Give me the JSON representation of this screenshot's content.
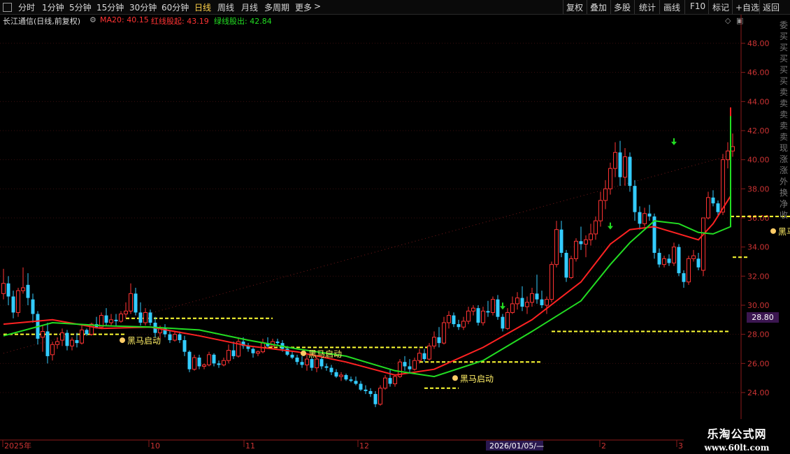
{
  "toolbar": {
    "items": [
      "分时",
      "1分钟",
      "5分钟",
      "15分钟",
      "30分钟",
      "60分钟",
      "日线",
      "周线",
      "月线",
      "多周期",
      "更多"
    ],
    "more_arrow": ">",
    "active": "日线",
    "right_items": [
      "复权",
      "叠加",
      "多股",
      "统计",
      "画线",
      "F10",
      "标记",
      "+自选",
      "返回"
    ]
  },
  "info": {
    "title": "长江通信(日线,前复权)",
    "ma20": "MA20: 40.15",
    "red_line": "红线股起: 43.19",
    "green_line": "绿线股出: 42.84"
  },
  "price_marker": "28.80",
  "right_strip": [
    "委",
    "买",
    "买",
    "买",
    "买",
    "买",
    "卖",
    "卖",
    "卖",
    "卖",
    "卖",
    "现",
    "涨",
    "涨",
    "外",
    "换",
    "净",
    "收"
  ],
  "watermark": {
    "line1": "乐淘公式网",
    "line2": "www.60lt.com"
  },
  "colors": {
    "up": "#ff3333",
    "down": "#33ccff",
    "signal": "#ff33cc",
    "green_bar": "#00dd00",
    "ma_red": "#ff2222",
    "ma_green": "#22dd22",
    "level": "#ffff33",
    "label": "#ffee66"
  },
  "chart_data": {
    "type": "candlestick",
    "y_range": [
      22.8,
      49.2
    ],
    "y_ticks": [
      "24.00",
      "26.00",
      "28.00",
      "30.00",
      "32.00",
      "34.00",
      "36.00",
      "38.00",
      "40.00",
      "42.00",
      "44.00",
      "46.00",
      "48.00"
    ],
    "x_labels": [
      "2025年",
      "10",
      "11",
      "12",
      "2026/01/05/—",
      "2",
      "2",
      "3"
    ],
    "n_bars": 150,
    "candles": [
      {
        "o": 30.8,
        "h": 32.5,
        "l": 30.4,
        "c": 31.5
      },
      {
        "o": 31.5,
        "h": 32.0,
        "l": 30.0,
        "c": 30.6
      },
      {
        "o": 30.6,
        "h": 31.0,
        "l": 29.1,
        "c": 29.5
      },
      {
        "o": 29.5,
        "h": 31.2,
        "l": 29.2,
        "c": 31.0
      },
      {
        "o": 31.0,
        "h": 32.6,
        "l": 30.8,
        "c": 31.2
      },
      {
        "o": 31.4,
        "h": 32.2,
        "l": 30.0,
        "c": 30.5
      },
      {
        "o": 30.4,
        "h": 30.8,
        "l": 28.8,
        "c": 29.4
      },
      {
        "o": 29.4,
        "h": 29.6,
        "l": 27.3,
        "c": 27.7
      },
      {
        "o": 27.8,
        "h": 28.6,
        "l": 26.8,
        "c": 28.2
      },
      {
        "o": 28.2,
        "h": 28.8,
        "l": 26.0,
        "c": 26.5
      },
      {
        "o": 26.6,
        "h": 27.5,
        "l": 26.2,
        "c": 27.3
      },
      {
        "o": 27.3,
        "h": 27.8,
        "l": 27.0,
        "c": 27.5
      },
      {
        "o": 27.6,
        "h": 28.4,
        "l": 27.2,
        "c": 28.1
      },
      {
        "o": 28.1,
        "h": 28.3,
        "l": 26.9,
        "c": 27.2
      },
      {
        "o": 27.2,
        "h": 27.8,
        "l": 26.9,
        "c": 27.6
      },
      {
        "o": 27.6,
        "h": 28.1,
        "l": 27.1,
        "c": 27.4
      },
      {
        "o": 27.4,
        "h": 28.6,
        "l": 27.3,
        "c": 28.3
      },
      {
        "o": 28.3,
        "h": 28.4,
        "l": 27.9,
        "c": 28.0
      },
      {
        "o": 28.0,
        "h": 28.8,
        "l": 27.9,
        "c": 28.7
      },
      {
        "o": 28.7,
        "h": 29.2,
        "l": 28.4,
        "c": 28.5
      },
      {
        "o": 28.5,
        "h": 29.5,
        "l": 28.4,
        "c": 29.3
      },
      {
        "o": 29.3,
        "h": 29.8,
        "l": 28.6,
        "c": 28.8
      },
      {
        "o": 28.8,
        "h": 29.4,
        "l": 28.6,
        "c": 29.0
      },
      {
        "o": 29.0,
        "h": 29.4,
        "l": 28.6,
        "c": 28.9
      },
      {
        "o": 28.9,
        "h": 29.6,
        "l": 28.8,
        "c": 29.4
      },
      {
        "o": 29.4,
        "h": 30.2,
        "l": 29.1,
        "c": 29.6
      },
      {
        "o": 29.6,
        "h": 31.5,
        "l": 29.4,
        "c": 30.8
      },
      {
        "o": 30.8,
        "h": 31.2,
        "l": 29.3,
        "c": 29.5
      },
      {
        "o": 29.5,
        "h": 30.2,
        "l": 28.6,
        "c": 28.8
      },
      {
        "o": 28.8,
        "h": 29.8,
        "l": 28.6,
        "c": 29.5
      },
      {
        "o": 29.5,
        "h": 29.7,
        "l": 28.6,
        "c": 28.8
      },
      {
        "o": 28.8,
        "h": 29.2,
        "l": 27.8,
        "c": 28.1
      },
      {
        "o": 28.1,
        "h": 28.6,
        "l": 27.7,
        "c": 28.4
      },
      {
        "o": 28.4,
        "h": 28.7,
        "l": 27.8,
        "c": 28.0
      },
      {
        "o": 28.0,
        "h": 28.3,
        "l": 27.4,
        "c": 27.6
      },
      {
        "o": 27.6,
        "h": 28.2,
        "l": 27.5,
        "c": 28.0
      },
      {
        "o": 28.0,
        "h": 28.2,
        "l": 27.4,
        "c": 27.6
      },
      {
        "o": 27.6,
        "h": 27.9,
        "l": 26.5,
        "c": 26.8
      },
      {
        "o": 26.8,
        "h": 26.9,
        "l": 25.4,
        "c": 25.6
      },
      {
        "o": 25.6,
        "h": 26.6,
        "l": 25.5,
        "c": 26.4
      },
      {
        "o": 26.4,
        "h": 26.6,
        "l": 25.6,
        "c": 25.8
      },
      {
        "o": 25.8,
        "h": 26.0,
        "l": 25.6,
        "c": 25.9
      },
      {
        "o": 25.9,
        "h": 26.8,
        "l": 25.8,
        "c": 26.6
      },
      {
        "o": 26.6,
        "h": 26.7,
        "l": 25.8,
        "c": 26.0
      },
      {
        "o": 26.0,
        "h": 26.2,
        "l": 25.7,
        "c": 25.9
      },
      {
        "o": 25.9,
        "h": 26.4,
        "l": 25.8,
        "c": 26.2
      },
      {
        "o": 26.2,
        "h": 27.3,
        "l": 26.0,
        "c": 26.9
      },
      {
        "o": 26.9,
        "h": 27.5,
        "l": 26.3,
        "c": 26.5
      },
      {
        "o": 26.5,
        "h": 27.8,
        "l": 26.4,
        "c": 27.5
      },
      {
        "o": 27.5,
        "h": 27.8,
        "l": 27.0,
        "c": 27.2
      },
      {
        "o": 27.2,
        "h": 27.4,
        "l": 26.8,
        "c": 27.0
      },
      {
        "o": 27.0,
        "h": 27.1,
        "l": 26.4,
        "c": 26.7
      },
      {
        "o": 26.7,
        "h": 26.9,
        "l": 26.5,
        "c": 26.8
      },
      {
        "o": 26.8,
        "h": 27.7,
        "l": 26.7,
        "c": 27.4
      },
      {
        "o": 27.4,
        "h": 27.8,
        "l": 27.0,
        "c": 27.2
      },
      {
        "o": 27.2,
        "h": 27.7,
        "l": 27.0,
        "c": 27.5
      },
      {
        "o": 27.5,
        "h": 27.7,
        "l": 27.2,
        "c": 27.4
      },
      {
        "o": 27.4,
        "h": 27.6,
        "l": 26.8,
        "c": 27.0
      },
      {
        "o": 27.0,
        "h": 27.2,
        "l": 26.5,
        "c": 26.6
      },
      {
        "o": 26.6,
        "h": 26.8,
        "l": 26.3,
        "c": 26.4
      },
      {
        "o": 26.4,
        "h": 26.6,
        "l": 25.9,
        "c": 26.1
      },
      {
        "o": 26.1,
        "h": 26.5,
        "l": 25.7,
        "c": 25.9
      },
      {
        "o": 25.9,
        "h": 26.6,
        "l": 25.5,
        "c": 26.3
      },
      {
        "o": 26.3,
        "h": 26.4,
        "l": 25.5,
        "c": 25.7
      },
      {
        "o": 25.7,
        "h": 26.5,
        "l": 25.4,
        "c": 26.3
      },
      {
        "o": 26.3,
        "h": 26.4,
        "l": 25.6,
        "c": 25.8
      },
      {
        "o": 25.8,
        "h": 26.0,
        "l": 25.5,
        "c": 25.7
      },
      {
        "o": 25.7,
        "h": 25.9,
        "l": 25.2,
        "c": 25.4
      },
      {
        "o": 25.4,
        "h": 25.6,
        "l": 25.0,
        "c": 25.1
      },
      {
        "o": 25.1,
        "h": 25.4,
        "l": 24.8,
        "c": 25.2
      },
      {
        "o": 25.2,
        "h": 25.3,
        "l": 24.8,
        "c": 24.9
      },
      {
        "o": 24.9,
        "h": 25.1,
        "l": 24.7,
        "c": 24.8
      },
      {
        "o": 24.8,
        "h": 25.1,
        "l": 24.5,
        "c": 24.6
      },
      {
        "o": 24.6,
        "h": 24.8,
        "l": 24.1,
        "c": 24.2
      },
      {
        "o": 24.2,
        "h": 24.5,
        "l": 23.9,
        "c": 24.1
      },
      {
        "o": 24.1,
        "h": 24.3,
        "l": 23.7,
        "c": 23.9
      },
      {
        "o": 23.9,
        "h": 24.1,
        "l": 23.0,
        "c": 23.2
      },
      {
        "o": 23.2,
        "h": 24.5,
        "l": 23.1,
        "c": 24.3
      },
      {
        "o": 24.3,
        "h": 25.2,
        "l": 24.2,
        "c": 25.0
      },
      {
        "o": 25.0,
        "h": 25.6,
        "l": 24.4,
        "c": 24.6
      },
      {
        "o": 24.6,
        "h": 25.2,
        "l": 24.4,
        "c": 25.1
      },
      {
        "o": 25.1,
        "h": 26.3,
        "l": 25.0,
        "c": 26.1
      },
      {
        "o": 26.1,
        "h": 26.5,
        "l": 25.5,
        "c": 25.8
      },
      {
        "o": 25.8,
        "h": 26.3,
        "l": 25.4,
        "c": 25.6
      },
      {
        "o": 25.6,
        "h": 26.4,
        "l": 25.5,
        "c": 26.2
      },
      {
        "o": 26.2,
        "h": 27.0,
        "l": 26.0,
        "c": 26.7
      },
      {
        "o": 26.7,
        "h": 27.0,
        "l": 26.1,
        "c": 26.3
      },
      {
        "o": 26.3,
        "h": 27.4,
        "l": 26.2,
        "c": 27.2
      },
      {
        "o": 27.2,
        "h": 28.2,
        "l": 27.0,
        "c": 27.8
      },
      {
        "o": 27.8,
        "h": 28.5,
        "l": 27.1,
        "c": 27.4
      },
      {
        "o": 27.4,
        "h": 29.2,
        "l": 27.3,
        "c": 28.8
      },
      {
        "o": 28.8,
        "h": 29.6,
        "l": 28.4,
        "c": 29.3
      },
      {
        "o": 29.3,
        "h": 29.5,
        "l": 28.5,
        "c": 28.7
      },
      {
        "o": 28.7,
        "h": 29.0,
        "l": 28.3,
        "c": 28.5
      },
      {
        "o": 28.5,
        "h": 29.2,
        "l": 28.3,
        "c": 28.9
      },
      {
        "o": 28.9,
        "h": 29.9,
        "l": 28.7,
        "c": 29.6
      },
      {
        "o": 29.6,
        "h": 30.0,
        "l": 29.3,
        "c": 29.8
      },
      {
        "o": 29.8,
        "h": 30.0,
        "l": 28.6,
        "c": 28.8
      },
      {
        "o": 28.8,
        "h": 29.9,
        "l": 28.6,
        "c": 29.6
      },
      {
        "o": 29.6,
        "h": 30.3,
        "l": 29.2,
        "c": 29.5
      },
      {
        "o": 29.5,
        "h": 30.6,
        "l": 29.3,
        "c": 30.4
      },
      {
        "o": 30.4,
        "h": 30.7,
        "l": 29.0,
        "c": 29.2
      },
      {
        "o": 29.2,
        "h": 29.4,
        "l": 28.2,
        "c": 28.4
      },
      {
        "o": 28.4,
        "h": 29.8,
        "l": 28.3,
        "c": 29.5
      },
      {
        "o": 29.5,
        "h": 30.6,
        "l": 29.4,
        "c": 30.1
      },
      {
        "o": 30.1,
        "h": 30.9,
        "l": 29.7,
        "c": 30.5
      },
      {
        "o": 30.5,
        "h": 31.3,
        "l": 29.6,
        "c": 29.9
      },
      {
        "o": 29.9,
        "h": 30.6,
        "l": 29.4,
        "c": 30.2
      },
      {
        "o": 30.2,
        "h": 31.2,
        "l": 29.9,
        "c": 30.8
      },
      {
        "o": 30.8,
        "h": 32.1,
        "l": 30.1,
        "c": 30.4
      },
      {
        "o": 30.4,
        "h": 31.0,
        "l": 29.8,
        "c": 30.0
      },
      {
        "o": 30.0,
        "h": 30.6,
        "l": 29.4,
        "c": 30.4
      },
      {
        "o": 30.4,
        "h": 33.0,
        "l": 30.2,
        "c": 32.8
      },
      {
        "o": 32.8,
        "h": 35.8,
        "l": 32.6,
        "c": 35.2
      },
      {
        "o": 35.2,
        "h": 35.8,
        "l": 33.3,
        "c": 33.6
      },
      {
        "o": 33.6,
        "h": 33.8,
        "l": 31.6,
        "c": 31.9
      },
      {
        "o": 31.9,
        "h": 33.4,
        "l": 31.8,
        "c": 33.2
      },
      {
        "o": 33.2,
        "h": 34.6,
        "l": 33.0,
        "c": 34.4
      },
      {
        "o": 34.4,
        "h": 35.4,
        "l": 33.8,
        "c": 34.2
      },
      {
        "o": 34.2,
        "h": 34.8,
        "l": 33.3,
        "c": 34.5
      },
      {
        "o": 34.5,
        "h": 35.6,
        "l": 34.1,
        "c": 34.9
      },
      {
        "o": 34.9,
        "h": 36.1,
        "l": 34.5,
        "c": 35.8
      },
      {
        "o": 35.8,
        "h": 37.8,
        "l": 35.4,
        "c": 37.2
      },
      {
        "o": 37.2,
        "h": 38.6,
        "l": 36.6,
        "c": 38.0
      },
      {
        "o": 38.0,
        "h": 39.8,
        "l": 37.6,
        "c": 39.4
      },
      {
        "o": 39.4,
        "h": 41.2,
        "l": 38.8,
        "c": 40.5
      },
      {
        "o": 40.5,
        "h": 41.3,
        "l": 38.2,
        "c": 38.8
      },
      {
        "o": 38.8,
        "h": 40.8,
        "l": 38.2,
        "c": 40.2
      },
      {
        "o": 40.2,
        "h": 40.5,
        "l": 37.8,
        "c": 38.2
      },
      {
        "o": 38.2,
        "h": 38.6,
        "l": 35.8,
        "c": 36.4
      },
      {
        "o": 36.4,
        "h": 36.8,
        "l": 35.2,
        "c": 35.6
      },
      {
        "o": 35.6,
        "h": 36.7,
        "l": 35.4,
        "c": 36.3
      },
      {
        "o": 36.3,
        "h": 36.9,
        "l": 35.8,
        "c": 36.1
      },
      {
        "o": 36.1,
        "h": 36.3,
        "l": 33.2,
        "c": 33.6
      },
      {
        "o": 33.6,
        "h": 33.9,
        "l": 32.6,
        "c": 32.8
      },
      {
        "o": 32.8,
        "h": 33.4,
        "l": 32.6,
        "c": 33.2
      },
      {
        "o": 33.2,
        "h": 33.5,
        "l": 32.7,
        "c": 32.9
      },
      {
        "o": 32.9,
        "h": 34.3,
        "l": 32.7,
        "c": 34.0
      },
      {
        "o": 34.0,
        "h": 34.2,
        "l": 32.0,
        "c": 32.2
      },
      {
        "o": 32.2,
        "h": 32.4,
        "l": 31.2,
        "c": 31.6
      },
      {
        "o": 31.6,
        "h": 33.4,
        "l": 31.4,
        "c": 33.2
      },
      {
        "o": 33.2,
        "h": 33.8,
        "l": 33.0,
        "c": 33.4
      },
      {
        "o": 33.2,
        "h": 33.6,
        "l": 32.4,
        "c": 32.6
      },
      {
        "o": 32.4,
        "h": 34.0,
        "l": 32.0,
        "c": 36.0
      },
      {
        "o": 36.0,
        "h": 37.8,
        "l": 35.9,
        "c": 37.4
      },
      {
        "o": 37.4,
        "h": 37.9,
        "l": 36.8,
        "c": 37.0
      },
      {
        "o": 37.0,
        "h": 37.2,
        "l": 36.2,
        "c": 36.4
      },
      {
        "o": 36.4,
        "h": 40.4,
        "l": 36.2,
        "c": 40.0
      },
      {
        "o": 40.0,
        "h": 41.2,
        "l": 39.4,
        "c": 40.6
      },
      {
        "o": 40.6,
        "h": 41.8,
        "l": 40.2,
        "c": 40.9
      }
    ],
    "ma_red": [
      [
        0,
        28.7
      ],
      [
        10,
        29.0
      ],
      [
        20,
        28.4
      ],
      [
        30,
        28.5
      ],
      [
        40,
        27.9
      ],
      [
        50,
        27.2
      ],
      [
        60,
        26.8
      ],
      [
        70,
        26.1
      ],
      [
        80,
        25.2
      ],
      [
        88,
        25.6
      ],
      [
        98,
        27.1
      ],
      [
        108,
        29.0
      ],
      [
        118,
        31.6
      ],
      [
        124,
        34.2
      ],
      [
        128,
        35.2
      ],
      [
        133,
        35.4
      ],
      [
        138,
        34.9
      ],
      [
        142,
        34.5
      ],
      [
        145,
        35.6
      ],
      [
        150,
        37.5
      ],
      [
        156,
        39.8
      ],
      [
        162,
        41.2
      ],
      [
        168,
        42.8
      ],
      [
        174,
        43.4
      ],
      [
        180,
        43.6
      ],
      [
        187,
        43.0
      ]
    ],
    "ma_green": [
      [
        0,
        27.9
      ],
      [
        10,
        28.8
      ],
      [
        20,
        28.6
      ],
      [
        30,
        28.5
      ],
      [
        40,
        28.3
      ],
      [
        50,
        27.6
      ],
      [
        60,
        27.0
      ],
      [
        70,
        26.5
      ],
      [
        80,
        25.5
      ],
      [
        88,
        25.1
      ],
      [
        98,
        26.2
      ],
      [
        108,
        28.2
      ],
      [
        118,
        30.3
      ],
      [
        124,
        32.8
      ],
      [
        128,
        34.3
      ],
      [
        133,
        35.8
      ],
      [
        138,
        35.6
      ],
      [
        142,
        35.0
      ],
      [
        145,
        34.9
      ],
      [
        150,
        35.4
      ],
      [
        156,
        37.5
      ],
      [
        162,
        39.6
      ],
      [
        168,
        41.5
      ],
      [
        174,
        42.7
      ],
      [
        180,
        43.0
      ],
      [
        187,
        42.8
      ]
    ],
    "signal_bars": [],
    "level_lines": [
      {
        "x0": 0,
        "x1": 25,
        "y": 28.0
      },
      {
        "x0": 25,
        "x1": 55,
        "y": 29.1
      },
      {
        "x0": 53,
        "x1": 87,
        "y": 27.1
      },
      {
        "x0": 85,
        "x1": 110,
        "y": 26.1
      },
      {
        "x0": 86,
        "x1": 93,
        "y": 24.3
      },
      {
        "x0": 112,
        "x1": 152,
        "y": 28.2
      },
      {
        "x0": 152,
        "x1": 162,
        "y": 33.3
      },
      {
        "x0": 163,
        "x1": 193,
        "y": 36.1
      }
    ],
    "horse_labels": [
      {
        "text": "黑马启动",
        "i": 24,
        "y": 27.5
      },
      {
        "text": "黑马启动",
        "i": 61,
        "y": 26.6
      },
      {
        "text": "黑马启动",
        "i": 92,
        "y": 24.9
      },
      {
        "text": "黑马启动",
        "i": 157,
        "y": 35.0
      }
    ],
    "arrows": [
      {
        "i": 102,
        "y": 29.7
      },
      {
        "i": 124,
        "y": 35.2
      },
      {
        "i": 137,
        "y": 41.0
      },
      {
        "i": 169,
        "y": 45.5
      }
    ]
  }
}
